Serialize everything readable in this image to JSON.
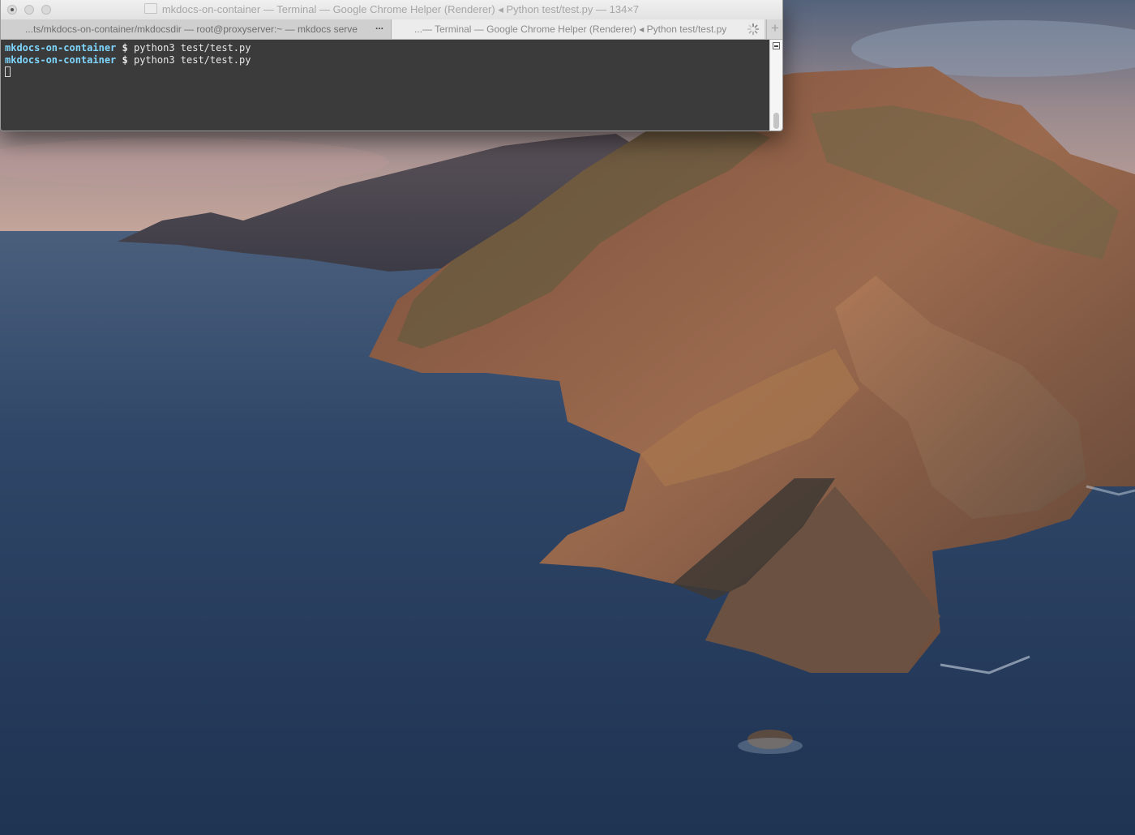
{
  "desktop": {
    "wallpaper": "mountain coastline over sea"
  },
  "terminal": {
    "title": "mkdocs-on-container — Terminal — Google Chrome Helper (Renderer) ◂ Python test/test.py — 134×7",
    "tabs": [
      {
        "label": "...ts/mkdocs-on-container/mkdocsdir — root@proxyserver:~ — mkdocs serve",
        "more": "..."
      },
      {
        "label": "...— Terminal — Google Chrome Helper (Renderer) ◂ Python test/test.py"
      }
    ],
    "new_tab_label": "+",
    "lines": [
      {
        "host": "mkdocs-on-container",
        "symbol": "$",
        "command": "python3 test/test.py"
      },
      {
        "host": "mkdocs-on-container",
        "symbol": "$",
        "command": "python3 test/test.py"
      }
    ]
  },
  "colors": {
    "prompt_host": "#7fd7ff",
    "terminal_bg": "#3b3b3b",
    "titlebar_bg": "#e8e8e8"
  }
}
